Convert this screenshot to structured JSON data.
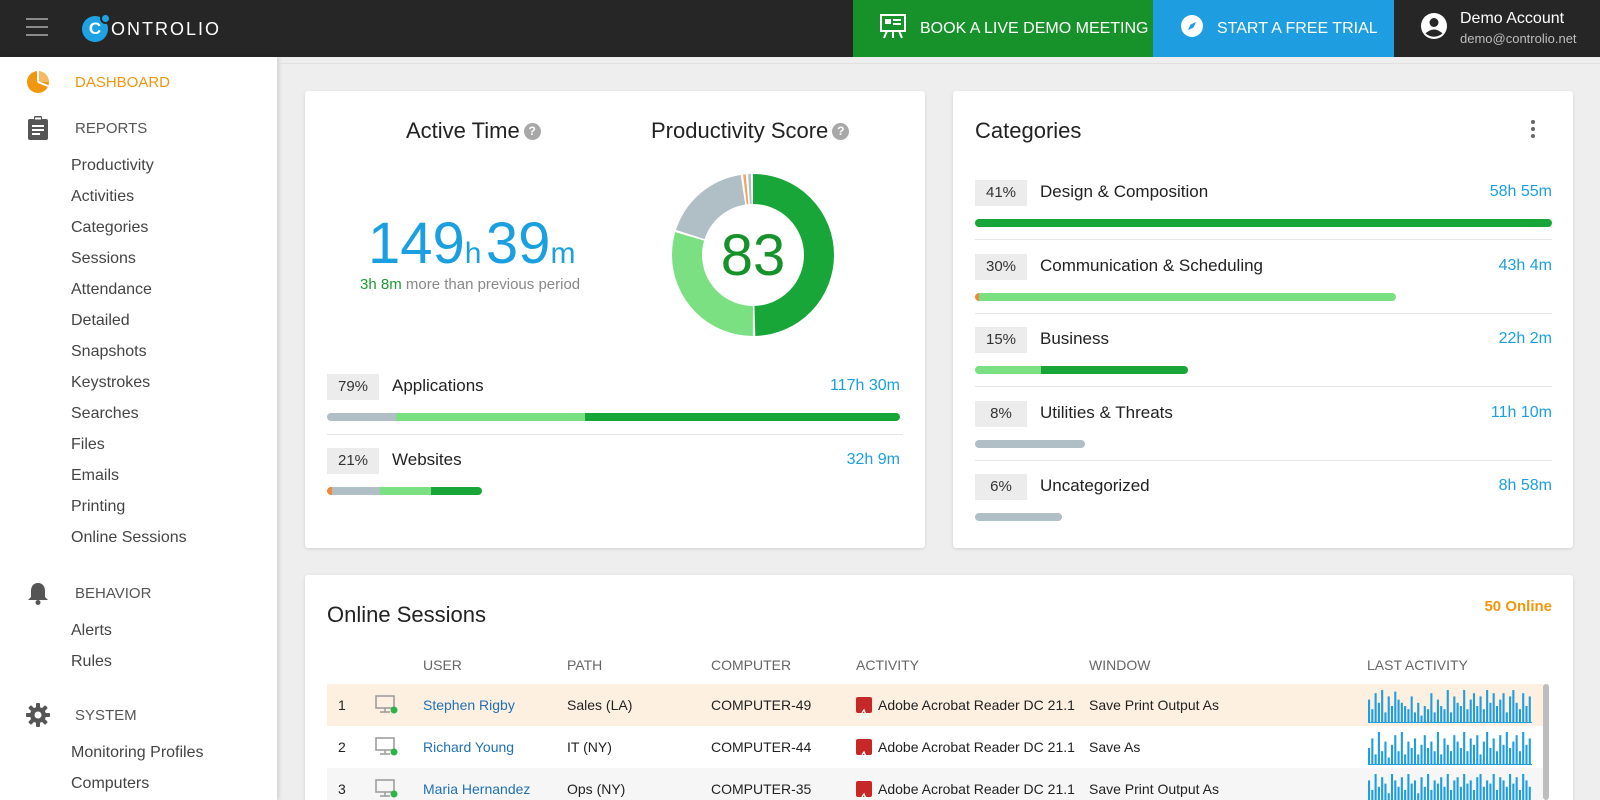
{
  "app": {
    "logo_text": "ONTROLIO",
    "logo_letter": "C",
    "book_demo": "BOOK A LIVE DEMO MEETING",
    "free_trial": "START A FREE TRIAL",
    "account_name": "Demo Account",
    "account_email": "demo@controlio.net"
  },
  "colors": {
    "accent_orange": "#f0960f",
    "accent_blue": "#1e9ee0",
    "accent_green": "#17922a",
    "light_green": "#7be081",
    "gray": "#b0bec5"
  },
  "sidebar": {
    "dashboard": "DASHBOARD",
    "reports": "REPORTS",
    "report_items": [
      "Productivity",
      "Activities",
      "Categories",
      "Sessions",
      "Attendance",
      "Detailed",
      "Snapshots",
      "Keystrokes",
      "Searches",
      "Files",
      "Emails",
      "Printing",
      "Online Sessions"
    ],
    "behavior": "BEHAVIOR",
    "behavior_items": [
      "Alerts",
      "Rules"
    ],
    "system": "SYSTEM",
    "system_items": [
      "Monitoring Profiles",
      "Computers"
    ]
  },
  "overview": {
    "active_time_title": "Active Time",
    "productivity_title": "Productivity Score",
    "help_glyph": "?",
    "hours": "149",
    "hours_unit": "h",
    "minutes": "39",
    "minutes_unit": "m",
    "diff_value": "3h 8m",
    "diff_text": "more than previous period",
    "score": "83",
    "score_segments": [
      {
        "name": "productive",
        "fraction": 0.5,
        "color": "#17a637"
      },
      {
        "name": "neutral",
        "fraction": 0.3,
        "color": "#7be081"
      },
      {
        "name": "unproductive",
        "fraction": 0.18,
        "color": "#b0bec5"
      },
      {
        "name": "other",
        "fraction": 0.01,
        "color": "#f4a261"
      },
      {
        "name": "gap",
        "fraction": 0.01,
        "color": "#b0bec5"
      }
    ],
    "rows": [
      {
        "pct": "79%",
        "label": "Applications",
        "value": "117h 30m",
        "bar_fill": 1.0,
        "segments": [
          {
            "fraction": 0.12,
            "color": "#b0bec5"
          },
          {
            "fraction": 0.33,
            "color": "#7be081"
          },
          {
            "fraction": 0.55,
            "color": "#17a637"
          }
        ]
      },
      {
        "pct": "21%",
        "label": "Websites",
        "value": "32h 9m",
        "bar_fill": 0.27,
        "segments": [
          {
            "fraction": 0.03,
            "color": "#f08a3a"
          },
          {
            "fraction": 0.31,
            "color": "#b0bec5"
          },
          {
            "fraction": 0.33,
            "color": "#7be081"
          },
          {
            "fraction": 0.33,
            "color": "#17a637"
          }
        ]
      }
    ]
  },
  "categories": {
    "title": "Categories",
    "rows": [
      {
        "pct": "41%",
        "label": "Design & Composition",
        "value": "58h 55m",
        "bar_fill": 1.0,
        "segments": [
          {
            "fraction": 1.0,
            "color": "#17a637"
          }
        ]
      },
      {
        "pct": "30%",
        "label": "Communication & Scheduling",
        "value": "43h 4m",
        "bar_fill": 0.73,
        "segments": [
          {
            "fraction": 0.01,
            "color": "#f08a3a"
          },
          {
            "fraction": 0.99,
            "color": "#7be081"
          }
        ]
      },
      {
        "pct": "15%",
        "label": "Business",
        "value": "22h 2m",
        "bar_fill": 0.37,
        "segments": [
          {
            "fraction": 0.31,
            "color": "#7be081"
          },
          {
            "fraction": 0.69,
            "color": "#17a637"
          }
        ]
      },
      {
        "pct": "8%",
        "label": "Utilities & Threats",
        "value": "11h 10m",
        "bar_fill": 0.19,
        "segments": [
          {
            "fraction": 1.0,
            "color": "#b0bec5"
          }
        ]
      },
      {
        "pct": "6%",
        "label": "Uncategorized",
        "value": "8h 58m",
        "bar_fill": 0.15,
        "segments": [
          {
            "fraction": 1.0,
            "color": "#b0bec5"
          }
        ]
      }
    ]
  },
  "online_sessions": {
    "title": "Online Sessions",
    "count": "50 Online",
    "columns": [
      "USER",
      "PATH",
      "COMPUTER",
      "ACTIVITY",
      "WINDOW",
      "LAST ACTIVITY"
    ],
    "rows": [
      {
        "index": "1",
        "user": "Stephen Rigby",
        "path": "Sales (LA)",
        "computer": "COMPUTER-49",
        "activity": "Adobe Acrobat Reader DC 21.1",
        "window": "Save Print Output As",
        "highlight": true,
        "spark": [
          0.7,
          0.4,
          0.9,
          0.6,
          1.0,
          0.3,
          0.8,
          0.5,
          0.95,
          0.7,
          0.6,
          0.5,
          0.4,
          0.8,
          0.3,
          0.6,
          0.2,
          0.5,
          0.4,
          0.9,
          0.3,
          0.7,
          0.5,
          0.4,
          1.0,
          0.3,
          0.8,
          0.6,
          0.5,
          1.0,
          0.4,
          0.7,
          0.9,
          0.5,
          0.8,
          0.4,
          1.0,
          0.6,
          0.9,
          0.5,
          0.7,
          0.9,
          0.3,
          0.8,
          1.0,
          0.6,
          0.4,
          0.9,
          0.5,
          0.8
        ]
      },
      {
        "index": "2",
        "user": "Richard Young",
        "path": "IT (NY)",
        "computer": "COMPUTER-44",
        "activity": "Adobe Acrobat Reader DC 21.1",
        "window": "Save As",
        "highlight": false,
        "spark": [
          0.5,
          0.8,
          0.3,
          1.0,
          0.4,
          0.7,
          0.2,
          0.6,
          0.9,
          0.4,
          1.0,
          0.3,
          0.7,
          0.5,
          0.8,
          0.3,
          0.6,
          0.9,
          0.5,
          0.7,
          0.4,
          1.0,
          0.3,
          0.8,
          0.6,
          0.4,
          0.9,
          0.7,
          0.5,
          1.0,
          0.4,
          0.8,
          0.6,
          0.9,
          0.3,
          0.7,
          1.0,
          0.5,
          0.8,
          0.4,
          0.9,
          0.6,
          1.0,
          0.5,
          0.7,
          0.9,
          0.4,
          1.0,
          0.6,
          0.8
        ]
      },
      {
        "index": "3",
        "user": "Maria Hernandez",
        "path": "Ops (NY)",
        "computer": "COMPUTER-35",
        "activity": "Adobe Acrobat Reader DC 21.1",
        "window": "Save Print Output As",
        "highlight": true,
        "spark": [
          0.8,
          0.5,
          1.0,
          0.6,
          0.9,
          0.7,
          0.4,
          1.0,
          0.8,
          0.6,
          0.9,
          0.5,
          1.0,
          0.7,
          0.8,
          0.4,
          0.9,
          0.6,
          1.0,
          0.5,
          0.8,
          0.7,
          0.9,
          0.6,
          1.0,
          0.5,
          0.8,
          0.9,
          0.6,
          1.0,
          0.7,
          0.8,
          0.5,
          0.9,
          1.0,
          0.6,
          0.8,
          0.7,
          1.0,
          0.5,
          0.9,
          0.8,
          0.6,
          1.0,
          0.7,
          0.9,
          0.5,
          1.0,
          0.8,
          0.6
        ]
      }
    ]
  }
}
